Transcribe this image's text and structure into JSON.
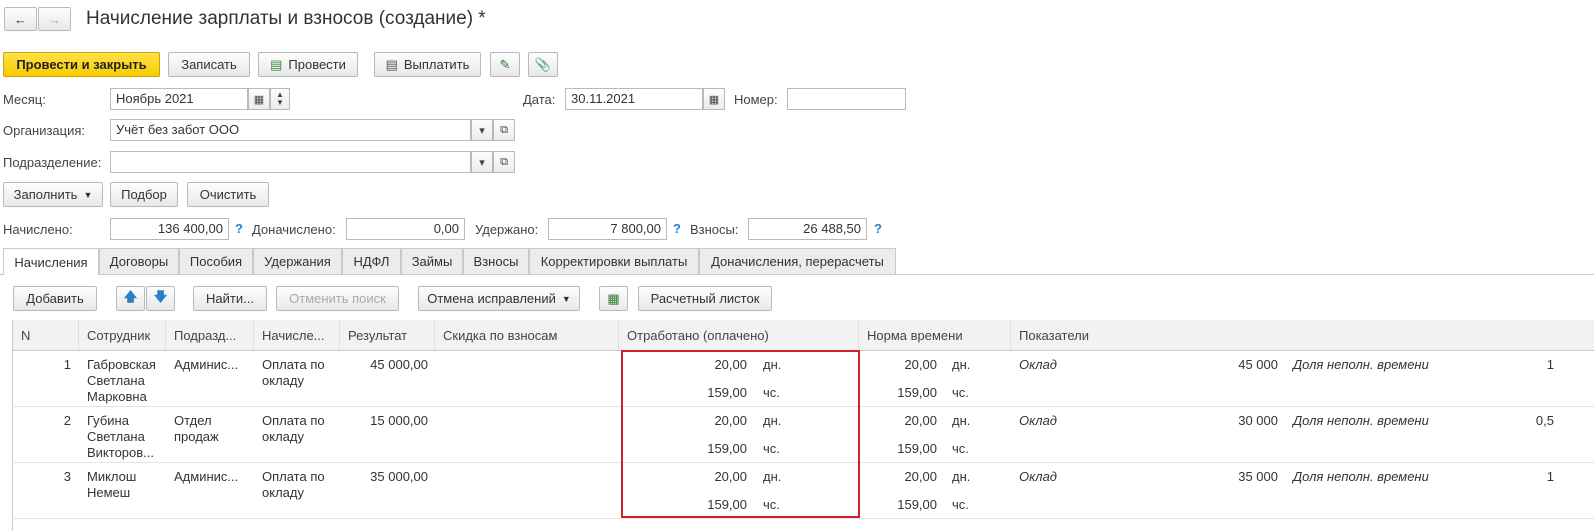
{
  "window": {
    "title": "Начисление зарплаты и взносов (создание) *"
  },
  "toolbar": {
    "post_close": "Провести и закрыть",
    "save": "Записать",
    "post": "Провести",
    "pay": "Выплатить"
  },
  "form": {
    "month_label": "Месяц:",
    "month_value": "Ноябрь 2021",
    "date_label": "Дата:",
    "date_value": "30.11.2021",
    "number_label": "Номер:",
    "number_value": "",
    "org_label": "Организация:",
    "org_value": "Учёт без забот ООО",
    "dept_label": "Подразделение:",
    "dept_value": ""
  },
  "actions": {
    "fill": "Заполнить",
    "select": "Подбор",
    "clear": "Очистить"
  },
  "totals": {
    "accrued_label": "Начислено:",
    "accrued_value": "136 400,00",
    "additional_label": "Доначислено:",
    "additional_value": "0,00",
    "withheld_label": "Удержано:",
    "withheld_value": "7 800,00",
    "contributions_label": "Взносы:",
    "contributions_value": "26 488,50",
    "help": "?"
  },
  "tabs": [
    "Начисления",
    "Договоры",
    "Пособия",
    "Удержания",
    "НДФЛ",
    "Займы",
    "Взносы",
    "Корректировки выплаты",
    "Доначисления, перерасчеты"
  ],
  "table_toolbar": {
    "add": "Добавить",
    "find": "Найти...",
    "cancel_search": "Отменить поиск",
    "cancel_corrections": "Отмена исправлений",
    "payslip": "Расчетный листок"
  },
  "table": {
    "headers": [
      "N",
      "Сотрудник",
      "Подразд...",
      "Начисле...",
      "Результат",
      "Скидка по взносам",
      "Отработано (оплачено)",
      "Норма времени",
      "Показатели"
    ],
    "rows": [
      {
        "n": "1",
        "employee": [
          "Габровская",
          "Светлана",
          "Марковна"
        ],
        "dept": [
          "Админис..."
        ],
        "accrual": [
          "Оплата по",
          "окладу"
        ],
        "result": "45 000,00",
        "worked_days": "20,00",
        "worked_hours": "159,00",
        "norm_days": "20,00",
        "norm_hours": "159,00",
        "days_unit": "дн.",
        "hours_unit": "чс.",
        "ind1_name": "Оклад",
        "ind1_value": "45 000",
        "ind2_name": "Доля неполн. времени",
        "ind2_value": "1"
      },
      {
        "n": "2",
        "employee": [
          "Губина",
          "Светлана",
          "Викторов..."
        ],
        "dept": [
          "Отдел",
          "продаж"
        ],
        "accrual": [
          "Оплата по",
          "окладу"
        ],
        "result": "15 000,00",
        "worked_days": "20,00",
        "worked_hours": "159,00",
        "norm_days": "20,00",
        "norm_hours": "159,00",
        "days_unit": "дн.",
        "hours_unit": "чс.",
        "ind1_name": "Оклад",
        "ind1_value": "30 000",
        "ind2_name": "Доля неполн. времени",
        "ind2_value": "0,5"
      },
      {
        "n": "3",
        "employee": [
          "Миклош",
          "Немеш"
        ],
        "dept": [
          "Админис..."
        ],
        "accrual": [
          "Оплата по",
          "окладу"
        ],
        "result": "35 000,00",
        "worked_days": "20,00",
        "worked_hours": "159,00",
        "norm_days": "20,00",
        "norm_hours": "159,00",
        "days_unit": "дн.",
        "hours_unit": "чс.",
        "ind1_name": "Оклад",
        "ind1_value": "35 000",
        "ind2_name": "Доля неполн. времени",
        "ind2_value": "1"
      }
    ]
  },
  "colors": {
    "primary_button": "#f7cc00",
    "highlight_box": "#d0202a",
    "help": "#2b7fc7"
  }
}
